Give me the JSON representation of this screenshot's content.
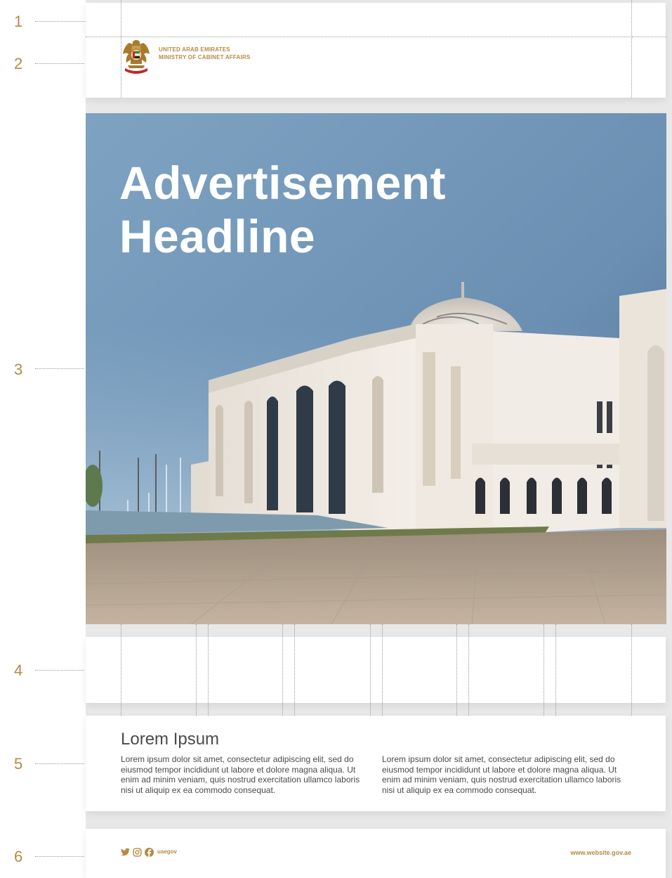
{
  "guides": [
    "1",
    "2",
    "3",
    "4",
    "5",
    "6"
  ],
  "header": {
    "org_line1": "UNITED ARAB EMIRATES",
    "org_line2": "MINISTRY OF CABINET AFFAIRS",
    "emblem_icon": "uae-emblem-icon"
  },
  "hero": {
    "headline_line1": "Advertisement",
    "headline_line2": "Headline"
  },
  "content": {
    "title": "Lorem Ipsum",
    "column1": "Lorem ipsum dolor sit amet, consectetur adipiscing elit, sed do eiusmod tempor incididunt ut labore et dolore magna aliqua. Ut enim ad minim veniam, quis nostrud exercitation ullamco laboris nisi ut aliquip ex ea commodo consequat.",
    "column2": "Lorem ipsum dolor sit amet, consectetur adipiscing elit, sed do eiusmod tempor incididunt ut labore et dolore magna aliqua. Ut enim ad minim veniam, quis nostrud exercitation ullamco laboris nisi ut aliquip ex ea commodo consequat."
  },
  "footer": {
    "social_icons": [
      "twitter-icon",
      "instagram-icon",
      "facebook-icon"
    ],
    "handle": "uaegov",
    "url": "www.website.gov.ae"
  },
  "colors": {
    "accent_gold": "#b78a43",
    "text_gray": "#4a4a4a",
    "background": "#e8e8e8"
  }
}
